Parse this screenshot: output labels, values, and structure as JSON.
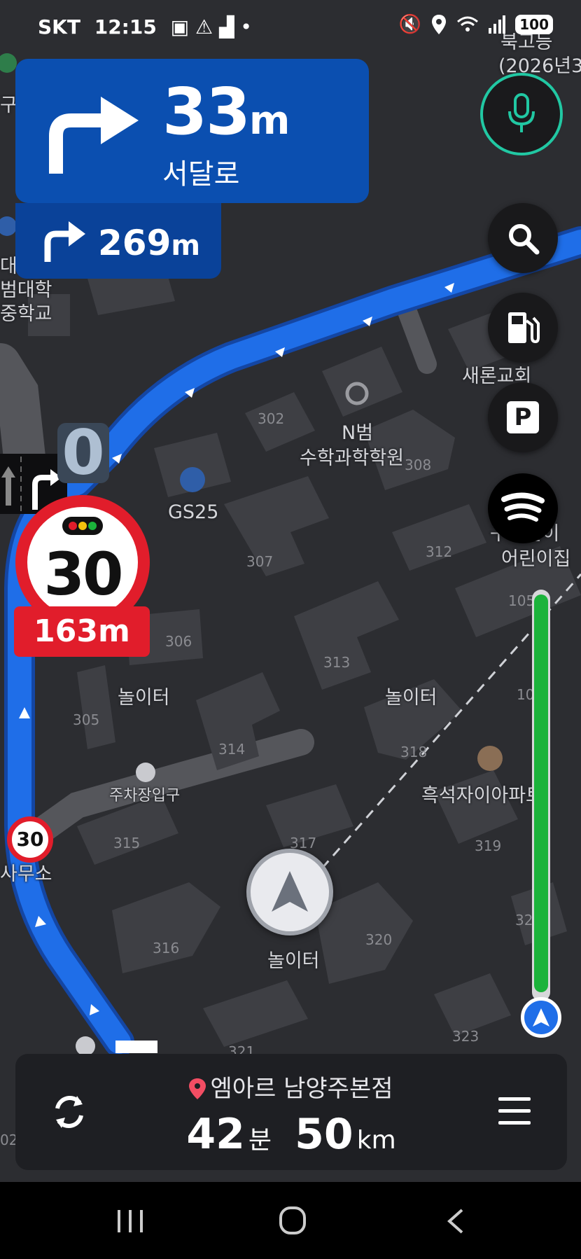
{
  "status_bar": {
    "carrier": "SKT",
    "time": "12:15",
    "battery": "100"
  },
  "guidance": {
    "primary": {
      "distance": "33",
      "unit": "m",
      "road": "서달로"
    },
    "next": {
      "distance": "269",
      "unit": "m"
    },
    "pending_count": "0"
  },
  "speed_limit": {
    "value": "30",
    "distance": "163m",
    "small_sign": "30"
  },
  "map_labels": {
    "poi_top_right": "북고등",
    "poi_top_right_sub": "(2026년3",
    "left_1": "구",
    "left_2": "대",
    "left_3": "범대학",
    "left_4": "중학교",
    "church": "새론교회",
    "academy_1": "N범",
    "academy_2": "수학과학학원",
    "gs25": "GS25",
    "kinder_1": "구두돌이",
    "kinder_2": "어린이집",
    "playground_1": "놀이터",
    "playground_2": "놀이터",
    "playground_3": "놀이터",
    "parking_entrance": "주차장입구",
    "apartment": "흑석자이아파트",
    "office": "사무소",
    "buildings": [
      "302",
      "308",
      "307",
      "312",
      "306",
      "313",
      "305",
      "314",
      "318",
      "315",
      "317",
      "319",
      "316",
      "320",
      "323",
      "321",
      "105",
      "10",
      "32",
      "02"
    ]
  },
  "progress": {
    "fraction": 0.99
  },
  "bottom_panel": {
    "destination": "엠아르 남양주본점",
    "minutes": "42",
    "minutes_unit": "분",
    "km": "50",
    "km_unit": "km"
  },
  "colors": {
    "route": "#1f6ee8",
    "banner": "#0b4fb0",
    "speed_red": "#e11d2b",
    "progress_green": "#1bb33b",
    "mic_ring": "#21c8a3"
  },
  "icons": [
    "mic-icon",
    "search-icon",
    "gas-station-icon",
    "parking-icon",
    "spotify-icon",
    "reroute-icon",
    "menu-icon",
    "destination-pin-icon"
  ]
}
